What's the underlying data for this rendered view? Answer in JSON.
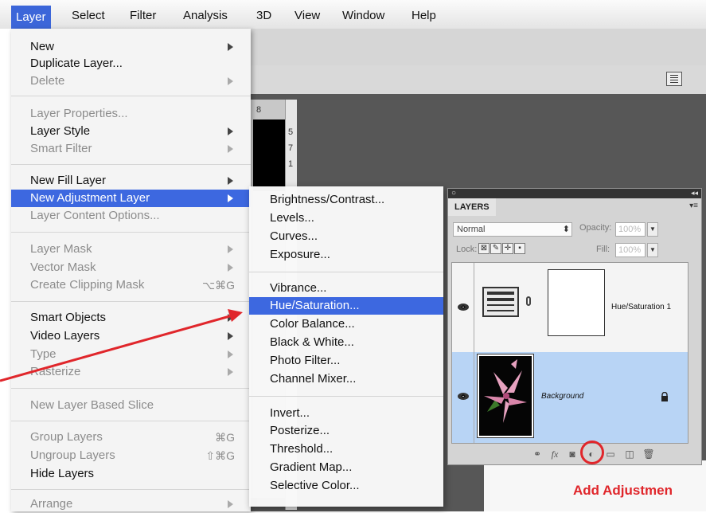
{
  "menubar": {
    "items": [
      "Layer",
      "Select",
      "Filter",
      "Analysis",
      "3D",
      "View",
      "Window",
      "Help"
    ],
    "active": "Layer"
  },
  "layer_menu": {
    "items": [
      {
        "label": "New",
        "state": "enabled",
        "submenu": true
      },
      {
        "label": "Duplicate Layer...",
        "state": "enabled"
      },
      {
        "label": "Delete",
        "state": "disabled",
        "submenu": true
      },
      {
        "label": "Layer Properties...",
        "state": "disabled"
      },
      {
        "label": "Layer Style",
        "state": "enabled",
        "submenu": true
      },
      {
        "label": "Smart Filter",
        "state": "disabled",
        "submenu": true
      },
      {
        "label": "New Fill Layer",
        "state": "enabled",
        "submenu": true
      },
      {
        "label": "New Adjustment Layer",
        "state": "highlighted",
        "submenu": true
      },
      {
        "label": "Layer Content Options...",
        "state": "disabled"
      },
      {
        "label": "Layer Mask",
        "state": "disabled",
        "submenu": true
      },
      {
        "label": "Vector Mask",
        "state": "disabled",
        "submenu": true
      },
      {
        "label": "Create Clipping Mask",
        "state": "disabled",
        "shortcut": "⌥⌘G"
      },
      {
        "label": "Smart Objects",
        "state": "enabled",
        "submenu": true
      },
      {
        "label": "Video Layers",
        "state": "enabled",
        "submenu": true
      },
      {
        "label": "Type",
        "state": "disabled",
        "submenu": true
      },
      {
        "label": "Rasterize",
        "state": "disabled",
        "submenu": true
      },
      {
        "label": "New Layer Based Slice",
        "state": "disabled"
      },
      {
        "label": "Group Layers",
        "state": "disabled",
        "shortcut": "⌘G"
      },
      {
        "label": "Ungroup Layers",
        "state": "disabled",
        "shortcut": "⇧⌘G"
      },
      {
        "label": "Hide Layers",
        "state": "enabled"
      },
      {
        "label": "Arrange",
        "state": "disabled",
        "submenu": true
      }
    ]
  },
  "adjustment_submenu": {
    "items": [
      {
        "label": "Brightness/Contrast...",
        "state": "enabled"
      },
      {
        "label": "Levels...",
        "state": "enabled"
      },
      {
        "label": "Curves...",
        "state": "enabled"
      },
      {
        "label": "Exposure...",
        "state": "enabled"
      },
      {
        "label": "Vibrance...",
        "state": "enabled"
      },
      {
        "label": "Hue/Saturation...",
        "state": "highlighted"
      },
      {
        "label": "Color Balance...",
        "state": "enabled"
      },
      {
        "label": "Black & White...",
        "state": "enabled"
      },
      {
        "label": "Photo Filter...",
        "state": "enabled"
      },
      {
        "label": "Channel Mixer...",
        "state": "enabled"
      },
      {
        "label": "Invert...",
        "state": "enabled"
      },
      {
        "label": "Posterize...",
        "state": "enabled"
      },
      {
        "label": "Threshold...",
        "state": "enabled"
      },
      {
        "label": "Gradient Map...",
        "state": "enabled"
      },
      {
        "label": "Selective Color...",
        "state": "enabled"
      }
    ]
  },
  "layers_panel": {
    "tab": "LAYERS",
    "blend_mode": "Normal",
    "opacity_label": "Opacity:",
    "opacity_value": "100%",
    "lock_label": "Lock:",
    "fill_label": "Fill:",
    "fill_value": "100%",
    "layers": [
      {
        "name": "Hue/Saturation 1",
        "visible": true
      },
      {
        "name": "Background",
        "visible": true,
        "locked": true
      }
    ],
    "bottom_icons": [
      "link-icon",
      "fx-icon",
      "mask-icon",
      "adjustment-icon",
      "folder-icon",
      "new-layer-icon",
      "trash-icon"
    ]
  },
  "ruler_marks": [
    "5",
    "7",
    "1",
    "8"
  ],
  "annotation": {
    "text": "Add Adjustmen",
    "color": "#e0262b"
  },
  "colors": {
    "highlight": "#3d68e0",
    "selected_layer": "#b8d4f5"
  }
}
